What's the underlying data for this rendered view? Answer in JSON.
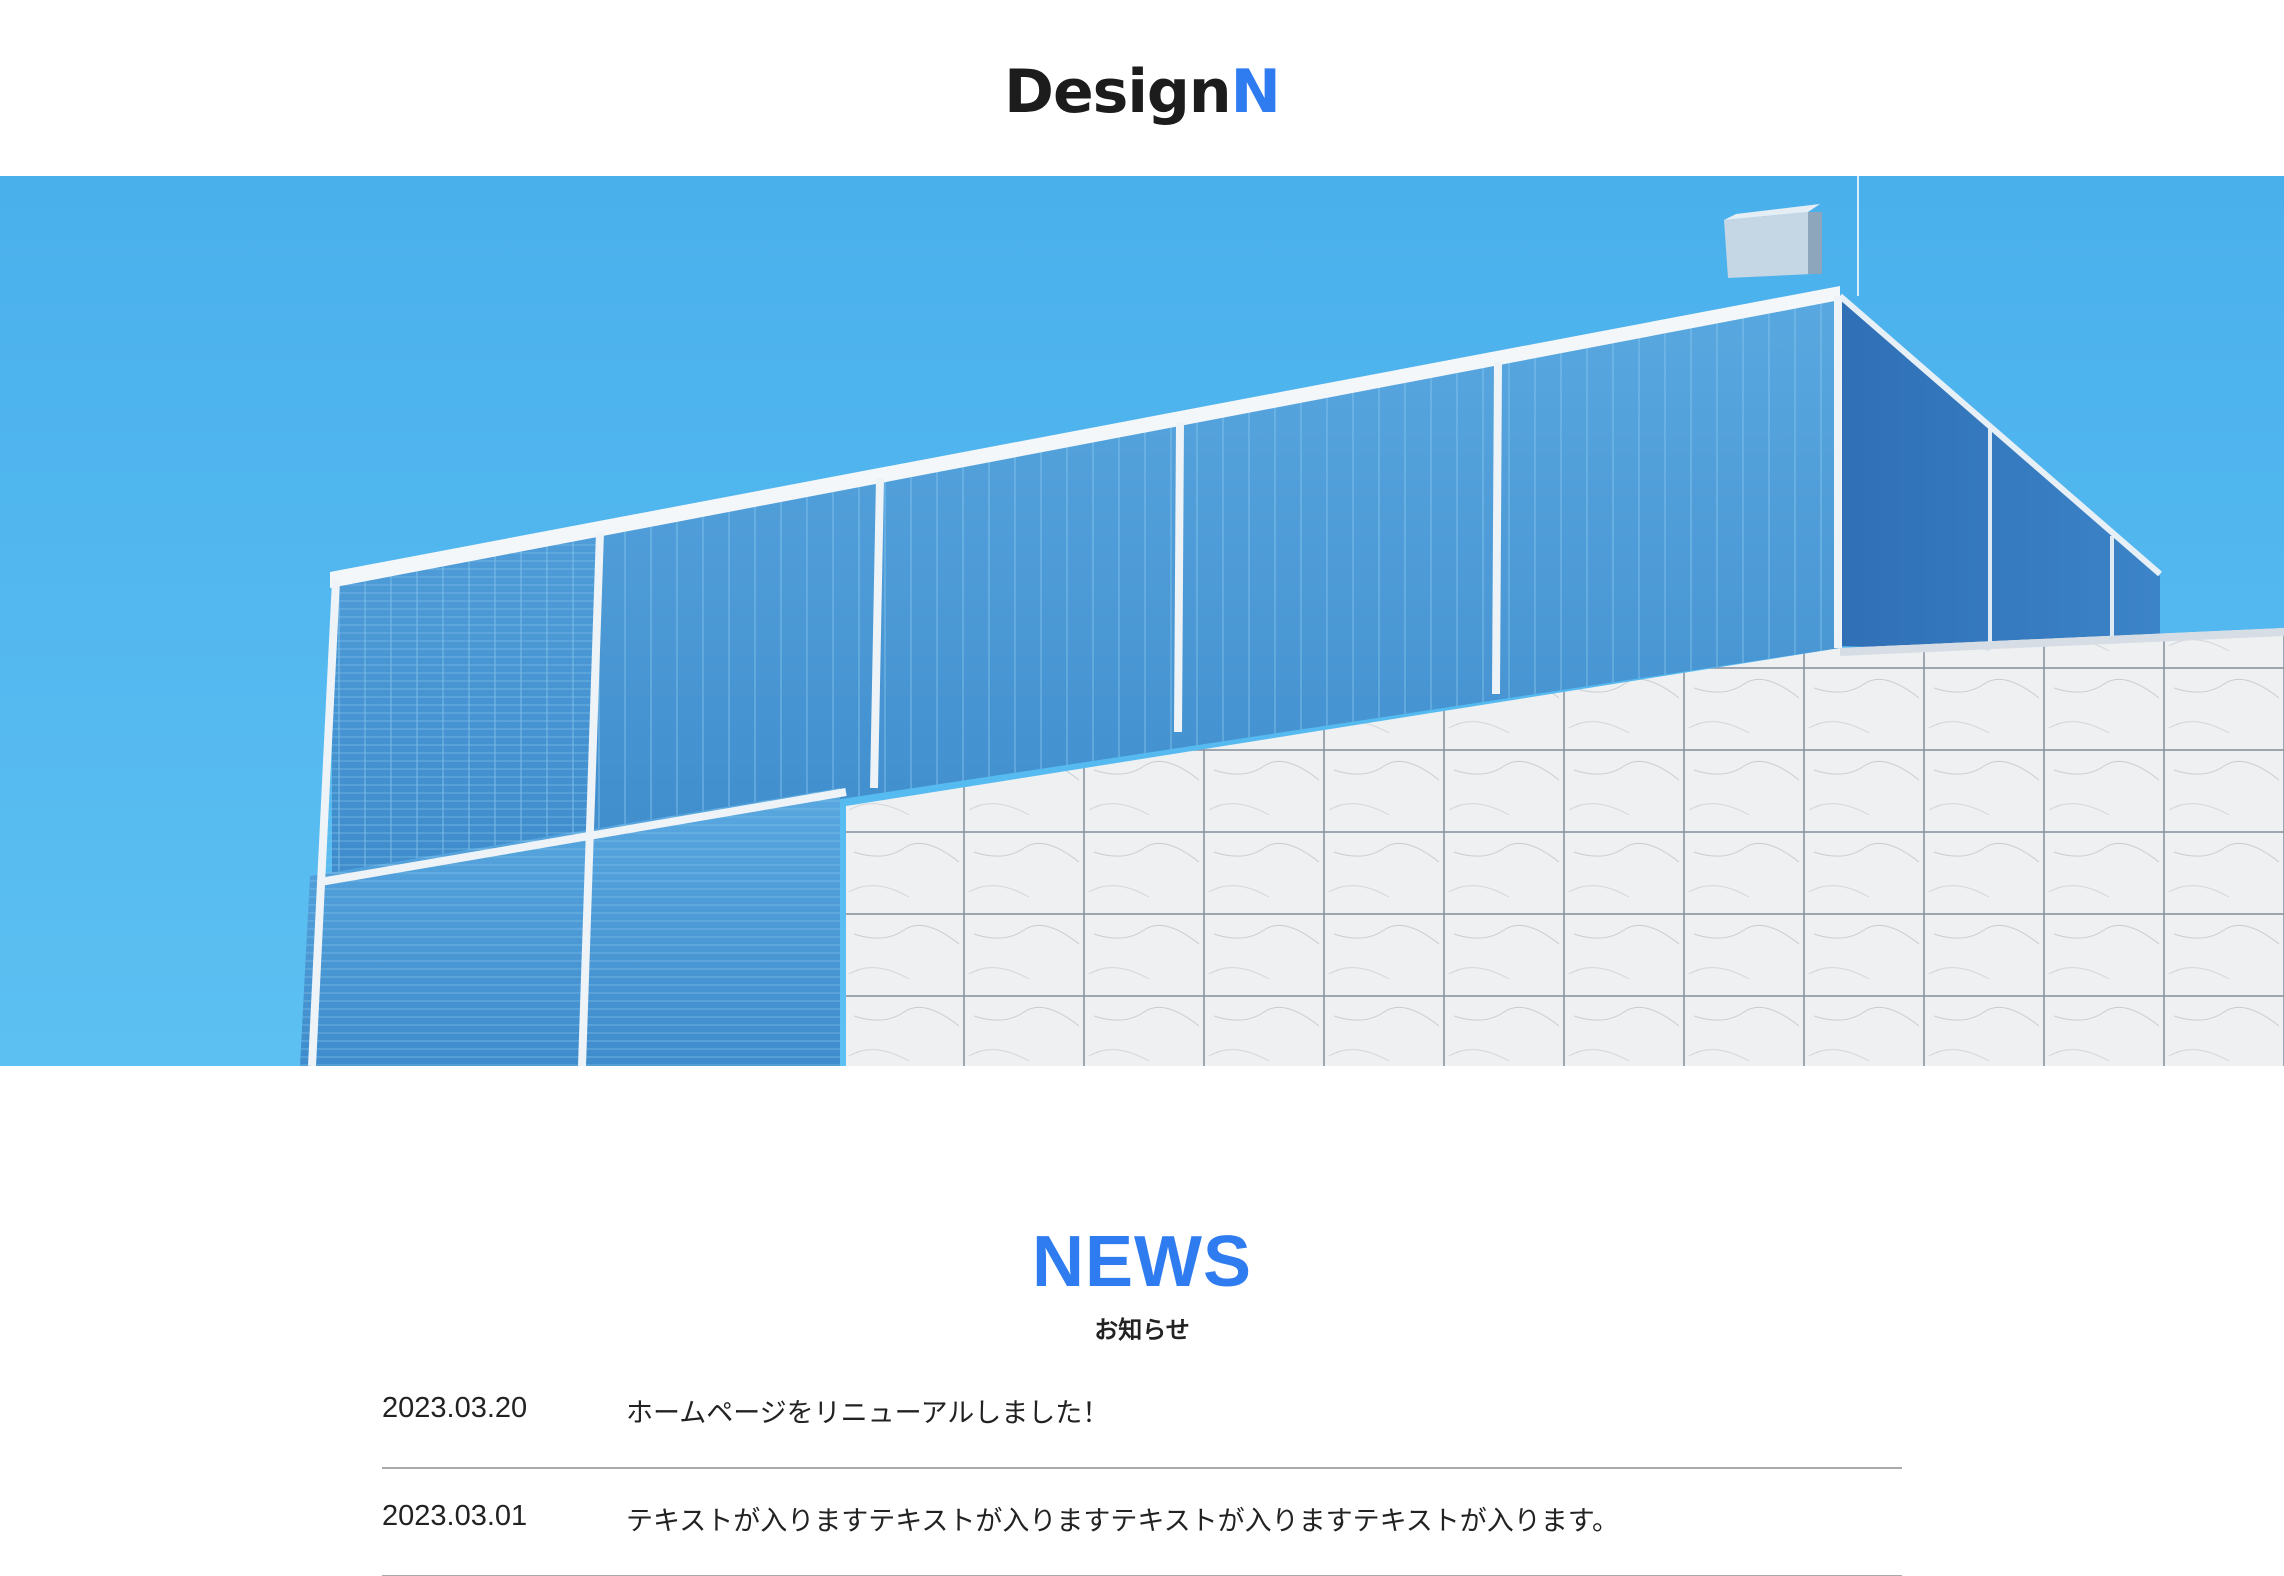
{
  "header": {
    "logo_main": "Design",
    "logo_accent": "N",
    "accent_color": "#2f7bf0"
  },
  "hero": {
    "image": "glass-building-against-blue-sky"
  },
  "news": {
    "title": "NEWS",
    "subtitle": "お知らせ",
    "items": [
      {
        "date": "2023.03.20",
        "text": "ホームページをリニューアルしました！"
      },
      {
        "date": "2023.03.01",
        "text": "テキストが入りますテキストが入りますテキストが入りますテキストが入ります。"
      }
    ]
  }
}
